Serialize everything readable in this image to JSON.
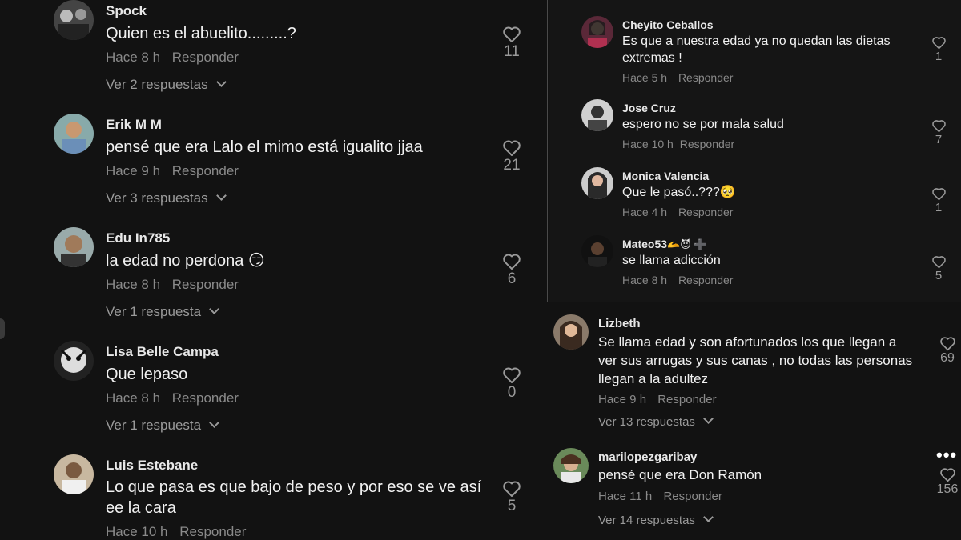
{
  "common": {
    "reply_label": "Responder"
  },
  "left_comments": [
    {
      "username": "Spock",
      "text": "Quien es el abuelito.........?",
      "time": "Hace 8 h",
      "likes": "11",
      "replies": "Ver 2 respuestas"
    },
    {
      "username": "Erik M M",
      "text": "pensé que era Lalo el mimo está igualito jjaa",
      "time": "Hace 9 h",
      "likes": "21",
      "replies": "Ver 3 respuestas"
    },
    {
      "username": "Edu In785",
      "text": "la edad no perdona 😏",
      "time": "Hace 8 h",
      "likes": "6",
      "replies": "Ver 1 respuesta"
    },
    {
      "username": "Lisa Belle Campa",
      "text": "Que lepaso",
      "time": "Hace 8 h",
      "likes": "0",
      "replies": "Ver 1 respuesta"
    },
    {
      "username": "Luis Estebane",
      "text": "Lo que pasa es que bajo de peso y por eso se ve así ee la cara",
      "time": "Hace 10 h",
      "likes": "5"
    }
  ],
  "right_top_comments": [
    {
      "username": "Cheyito Ceballos",
      "text": "Es que a nuestra edad ya no quedan las dietas extremas !",
      "time": "Hace 5 h",
      "likes": "1"
    },
    {
      "username": "Jose Cruz",
      "text": "espero no se por mala salud",
      "time": "Hace 10 h",
      "likes": "7"
    },
    {
      "username": "Monica Valencia",
      "text": "Que le pasó..???🥺",
      "time": "Hace 4 h",
      "likes": "1"
    },
    {
      "username": "Mateo53",
      "badges": "🫴😈 ➕",
      "text": "se llama adicción",
      "time": "Hace 8 h",
      "likes": "5"
    }
  ],
  "right_bottom_comments": [
    {
      "username": "Lizbeth",
      "text": "Se llama edad y son afortunados los que llegan a ver sus arrugas y sus canas , no todas las personas llegan a la adultez",
      "time": "Hace 9 h",
      "likes": "69",
      "replies": "Ver 13 respuestas"
    },
    {
      "username": "marilopezgaribay",
      "text": "pensé que era Don Ramón",
      "time": "Hace 11 h",
      "likes": "156",
      "replies": "Ver 14 respuestas"
    }
  ],
  "icons": {
    "like": "heart-outline-icon",
    "expand": "chevron-down-icon",
    "more": "more-options-icon"
  },
  "colors": {
    "background": "#121212",
    "text": "#f1f1f1",
    "muted": "#8a8a8a"
  }
}
